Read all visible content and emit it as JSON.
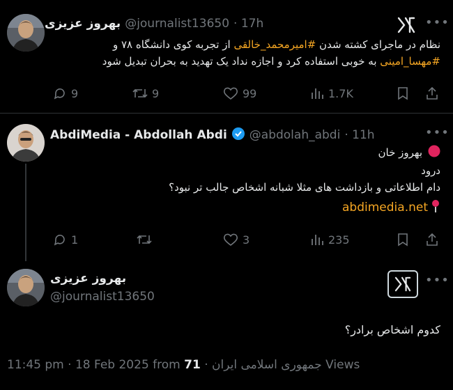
{
  "tweet1": {
    "display_name": "بهروز عزیزی",
    "handle": "@journalist13650",
    "time": "· 17h",
    "line1_pre": "نظام در ماجرای کشته شدن ",
    "line1_hashtag": "#امیرمحمد_خالقی",
    "line1_post": " از تجربه کوی دانشگاه ۷۸ و",
    "line2_hashtag": "#مهسا_امینی",
    "line2_post": " به خوبی استفاده کرد و اجازه نداد یک تهدید به بحران تبدیل شود",
    "replies": "9",
    "retweets": "9",
    "likes": "99",
    "views": "1.7K"
  },
  "tweet2": {
    "display_name": "AbdiMedia - Abdollah Abdi",
    "handle": "@abdolah_abdi",
    "time": "· 11h",
    "line1": "بهروز خان",
    "line2": "درود",
    "line3": "دام اطلاعاتی و بازداشت های مثلا شبانه اشخاص جالب تر نبود؟",
    "link": "abdimedia.net",
    "replies": "1",
    "likes": "3",
    "views": "235"
  },
  "tweet3": {
    "display_name": "بهروز عزیزی",
    "handle": "@journalist13650",
    "body": "کدوم اشخاص برادر؟",
    "meta_time": "11:45 pm · 18 Feb 2025 from ",
    "meta_location": "جمهوری اسلامی ایران",
    "meta_sep": " · ",
    "meta_views_count": "71",
    "meta_views_label": " Views"
  },
  "colors": {
    "accent": "#f5a623",
    "verified": "#1d9bf0",
    "muted": "#71767b",
    "red_dot": "#e0245e"
  },
  "icons": [
    "x-logo-icon",
    "more-icon",
    "reply-icon",
    "retweet-icon",
    "like-icon",
    "views-icon",
    "bookmark-icon",
    "share-icon",
    "verified-badge-icon",
    "red-circle-icon",
    "pin-icon"
  ]
}
